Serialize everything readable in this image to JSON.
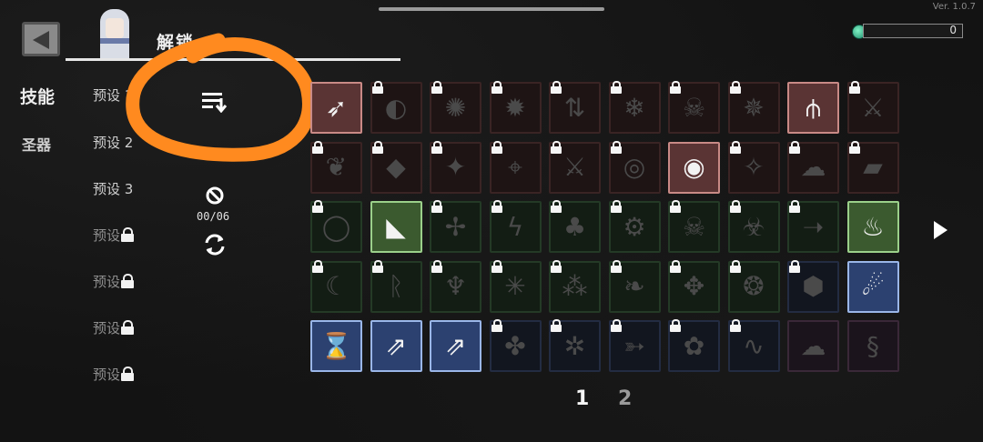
{
  "app": {
    "version": "Ver. 1.0.7"
  },
  "header": {
    "title": "解锁"
  },
  "currency": {
    "value": "0"
  },
  "sidebar": {
    "categories": [
      {
        "label": "技能",
        "selected": true
      },
      {
        "label": "圣器",
        "selected": false
      }
    ]
  },
  "presets": [
    {
      "label": "预设 1",
      "locked": false
    },
    {
      "label": "预设 2",
      "locked": false
    },
    {
      "label": "预设 3",
      "locked": false
    },
    {
      "label": "预设",
      "locked": true
    },
    {
      "label": "预设",
      "locked": true
    },
    {
      "label": "预设",
      "locked": true
    },
    {
      "label": "预设",
      "locked": true
    }
  ],
  "controls": {
    "sort_icon": "sort-list-icon",
    "clear_icon": "prohibit-icon",
    "equipped_counter": "00/06",
    "refresh_icon": "refresh-icon"
  },
  "skill_grid": {
    "rows": [
      [
        {
          "icon": "slash-icon",
          "style": "bright-red",
          "locked": false
        },
        {
          "icon": "orb-slash-icon",
          "style": "dim-red",
          "locked": true
        },
        {
          "icon": "beast-icon",
          "style": "dim-red",
          "locked": true
        },
        {
          "icon": "burst-icon",
          "style": "dim-red",
          "locked": true
        },
        {
          "icon": "arrows-icon",
          "style": "dim-red",
          "locked": true
        },
        {
          "icon": "snowflake-icon",
          "style": "dim-red",
          "locked": true
        },
        {
          "icon": "skull-icon",
          "style": "dim-red",
          "locked": true
        },
        {
          "icon": "vortex-icon",
          "style": "dim-red",
          "locked": true
        },
        {
          "icon": "tridents-icon",
          "style": "bright-red",
          "locked": false
        },
        {
          "icon": "claw-icon",
          "style": "dim-red",
          "locked": true
        }
      ],
      [
        {
          "icon": "feather-icon",
          "style": "dim-red",
          "locked": true
        },
        {
          "icon": "shards-icon",
          "style": "dim-red",
          "locked": true
        },
        {
          "icon": "scatter-icon",
          "style": "dim-red",
          "locked": true
        },
        {
          "icon": "target-icon",
          "style": "dim-red",
          "locked": true
        },
        {
          "icon": "crossed-swords-icon",
          "style": "dim-red",
          "locked": true
        },
        {
          "icon": "swirl-icon",
          "style": "dim-red",
          "locked": true
        },
        {
          "icon": "bullseye-icon",
          "style": "bright-red",
          "locked": false
        },
        {
          "icon": "spark-icon",
          "style": "dim-red",
          "locked": true
        },
        {
          "icon": "cloud-icon",
          "style": "dim-red",
          "locked": true
        },
        {
          "icon": "cannon-icon",
          "style": "dim-red",
          "locked": true
        }
      ],
      [
        {
          "icon": "ring-icon",
          "style": "dim-green",
          "locked": true
        },
        {
          "icon": "spike-icon",
          "style": "bright-green",
          "locked": false
        },
        {
          "icon": "barbed-icon",
          "style": "dim-green",
          "locked": true
        },
        {
          "icon": "lightning-icon",
          "style": "dim-green",
          "locked": true
        },
        {
          "icon": "plant-icon",
          "style": "dim-green",
          "locked": true
        },
        {
          "icon": "gear-icon",
          "style": "dim-green",
          "locked": true
        },
        {
          "icon": "skull-cloud-icon",
          "style": "dim-green",
          "locked": true
        },
        {
          "icon": "biohazard-icon",
          "style": "dim-green",
          "locked": true
        },
        {
          "icon": "spear-icon",
          "style": "dim-green",
          "locked": true
        },
        {
          "icon": "potion-icon",
          "style": "bright-green",
          "locked": false
        }
      ],
      [
        {
          "icon": "crescent-icon",
          "style": "dim-green",
          "locked": true
        },
        {
          "icon": "runes-icon",
          "style": "dim-green",
          "locked": true
        },
        {
          "icon": "wings-icon",
          "style": "dim-green",
          "locked": true
        },
        {
          "icon": "sparkle-icon",
          "style": "dim-green",
          "locked": true
        },
        {
          "icon": "dust-icon",
          "style": "dim-green",
          "locked": true
        },
        {
          "icon": "leaf-icon",
          "style": "dim-green",
          "locked": true
        },
        {
          "icon": "shuriken-icon",
          "style": "dim-green",
          "locked": true
        },
        {
          "icon": "wheel-icon",
          "style": "dim-green",
          "locked": true
        },
        {
          "icon": "hexagon-icon",
          "style": "dim-blue",
          "locked": true
        },
        {
          "icon": "ghost-flame-icon",
          "style": "bright-blue",
          "locked": false
        }
      ],
      [
        {
          "icon": "hourglass-icon",
          "style": "bright-blue",
          "locked": false
        },
        {
          "icon": "climb-icon",
          "style": "bright-blue",
          "locked": false
        },
        {
          "icon": "climb-boost-icon",
          "style": "bright-blue",
          "locked": false
        },
        {
          "icon": "fish-icon",
          "style": "dim-blue",
          "locked": true
        },
        {
          "icon": "crab-icon",
          "style": "dim-blue",
          "locked": true
        },
        {
          "icon": "bow-icon",
          "style": "dim-blue",
          "locked": true
        },
        {
          "icon": "rose-icon",
          "style": "dim-blue",
          "locked": true
        },
        {
          "icon": "wave-icon",
          "style": "dim-blue",
          "locked": true
        },
        {
          "icon": "smoke-icon",
          "style": "dim-purple",
          "locked": false
        },
        {
          "icon": "serpent-icon",
          "style": "dim-purple",
          "locked": false
        }
      ]
    ]
  },
  "pagination": {
    "pages": [
      "1",
      "2"
    ],
    "current": 1
  },
  "colors": {
    "background": "#131313",
    "highlight_red": "#c98a86",
    "highlight_green": "#9bd08a",
    "highlight_blue": "#9ab6e8",
    "annotation_orange": "#ff8a1f"
  }
}
